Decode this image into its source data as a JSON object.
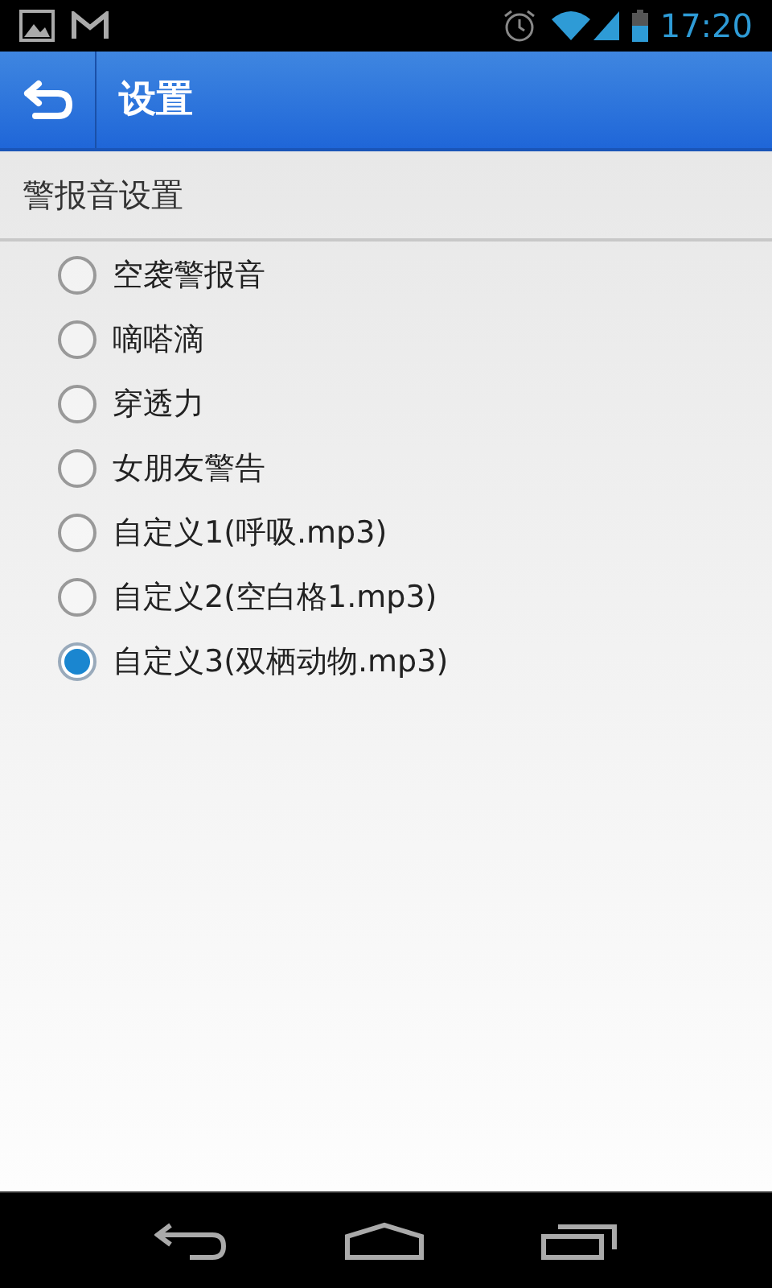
{
  "status_bar": {
    "time": "17:20"
  },
  "action_bar": {
    "title": "设置"
  },
  "section": {
    "title": "警报音设置"
  },
  "options": [
    {
      "label": "空袭警报音",
      "selected": false
    },
    {
      "label": "嘀嗒滴",
      "selected": false
    },
    {
      "label": "穿透力",
      "selected": false
    },
    {
      "label": "女朋友警告",
      "selected": false
    },
    {
      "label": "自定义1(呼吸.mp3)",
      "selected": false
    },
    {
      "label": "自定义2(空白格1.mp3)",
      "selected": false
    },
    {
      "label": "自定义3(双栖动物.mp3)",
      "selected": true
    }
  ]
}
